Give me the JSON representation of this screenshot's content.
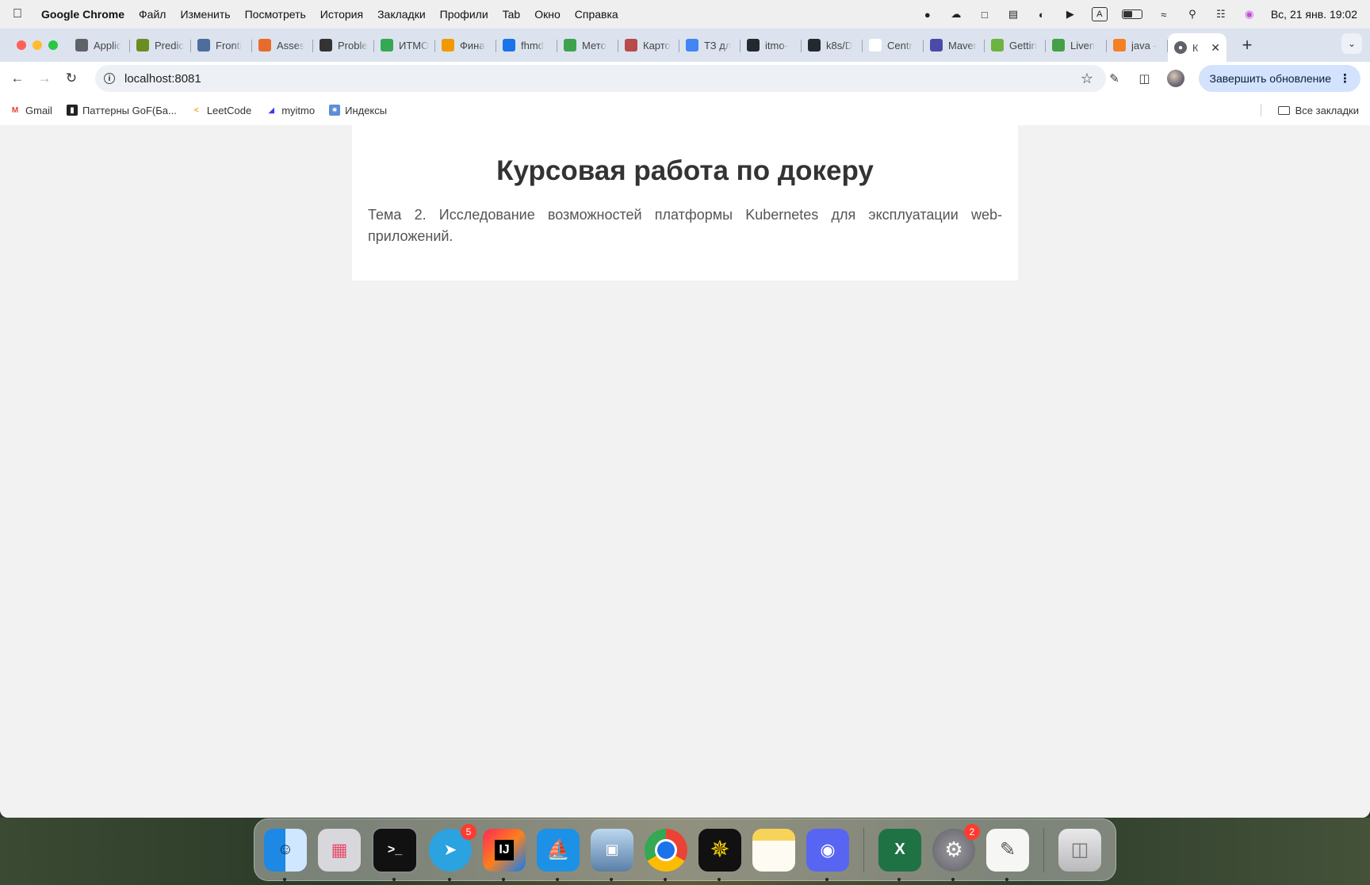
{
  "menubar": {
    "app_name": "Google Chrome",
    "items": [
      "Файл",
      "Изменить",
      "Посмотреть",
      "История",
      "Закладки",
      "Профили",
      "Tab",
      "Окно",
      "Справка"
    ],
    "clock": "Вс, 21 янв.  19:02"
  },
  "tabs": [
    {
      "title": "Applic",
      "color": "#5f6368"
    },
    {
      "title": "Predic",
      "color": "#6b8e23"
    },
    {
      "title": "Fronti",
      "color": "#4b6e9c"
    },
    {
      "title": "Asses",
      "color": "#e96b2c"
    },
    {
      "title": "Proble",
      "color": "#333333"
    },
    {
      "title": "ИТМО",
      "color": "#34a853"
    },
    {
      "title": "Фина",
      "color": "#f29900"
    },
    {
      "title": "fhmd",
      "color": "#1a73e8"
    },
    {
      "title": "Мето",
      "color": "#3fa34d"
    },
    {
      "title": "Карто",
      "color": "#b84a4a"
    },
    {
      "title": "ТЗ дл",
      "color": "#4285f4"
    },
    {
      "title": "itmo-",
      "color": "#24292f"
    },
    {
      "title": "k8s/D",
      "color": "#24292f"
    },
    {
      "title": "Centr",
      "color": "#ffffff"
    },
    {
      "title": "Maver",
      "color": "#4a4aa8"
    },
    {
      "title": "Gettin",
      "color": "#6db33f"
    },
    {
      "title": "Liven",
      "color": "#43a047"
    },
    {
      "title": "java -",
      "color": "#f48024"
    }
  ],
  "active_tab": {
    "title": "К"
  },
  "toolbar": {
    "url": "localhost:8081",
    "update_label": "Завершить обновление"
  },
  "bookmarks": {
    "items": [
      {
        "label": "Gmail",
        "color": "#ea4335"
      },
      {
        "label": "Паттерны GoF(Ба...",
        "color": "#222222"
      },
      {
        "label": "LeetCode",
        "color": "#f89f1b"
      },
      {
        "label": "myitmo",
        "color": "#3a3af2"
      },
      {
        "label": "Индексы",
        "color": "#5b8fd6"
      }
    ],
    "all_label": "Все закладки"
  },
  "page": {
    "title": "Курсовая работа по докеру",
    "description": "Тема 2. Исследование возможностей платформы Kubernetes для эксплуатации web-приложений."
  },
  "dock": {
    "badges": {
      "telegram": "5",
      "settings": "2"
    },
    "intellij_label": "IJ",
    "excel_label": "X"
  }
}
